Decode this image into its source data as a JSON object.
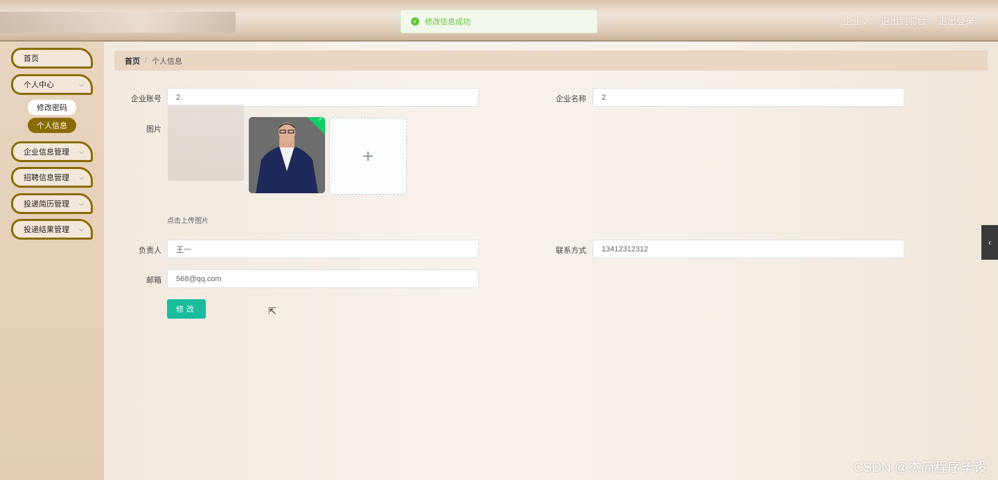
{
  "header": {
    "user": "企业 2",
    "nav": [
      "退出到前台",
      "退出登录"
    ]
  },
  "toast": {
    "message": "修改信息成功"
  },
  "sidebar": {
    "items": [
      {
        "label": "首页"
      },
      {
        "label": "个人中心"
      },
      {
        "label": "企业信息管理"
      },
      {
        "label": "招聘信息管理"
      },
      {
        "label": "投递简历管理"
      },
      {
        "label": "投递结果管理"
      }
    ],
    "sub_items": [
      {
        "label": "修改密码"
      },
      {
        "label": "个人信息"
      }
    ]
  },
  "breadcrumb": {
    "home": "首页",
    "separator": "/",
    "current": "个人信息"
  },
  "form": {
    "account_label": "企业账号",
    "account_value": "2",
    "name_label": "企业名称",
    "name_value": "2",
    "image_label": "图片",
    "upload_hint": "点击上传图片",
    "contact_person_label": "负责人",
    "contact_person_value": "王一",
    "phone_label": "联系方式",
    "phone_value": "13412312312",
    "email_label": "邮箱",
    "email_value": "568@qq.com",
    "submit_label": "修改"
  },
  "watermark": "CSDN @杰简程序毕设",
  "colors": {
    "accent": "#8a6b00",
    "submit": "#1abc9c",
    "success": "#67c23a"
  }
}
